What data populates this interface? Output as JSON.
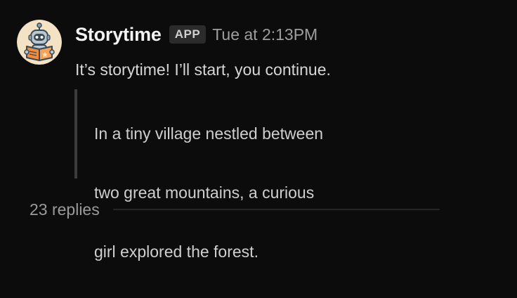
{
  "message": {
    "author": "Storytime",
    "badge": "APP",
    "timestamp": "Tue at 2:13PM",
    "text": "It’s storytime! I’ll start, you continue.",
    "quote_lines": [
      "In a tiny village nestled between",
      "two great mountains, a curious",
      "girl explored the forest."
    ],
    "replies": "23 replies"
  },
  "avatar": {
    "icon": "robot-reading-book-icon",
    "background": "#f3e3c4",
    "book_color": "#f08a3c"
  },
  "colors": {
    "background": "#0c0c0c",
    "author": "#f2f2f2",
    "text": "#d6d6d6",
    "muted": "#9e9e9e",
    "badge_bg": "#2b2b2b",
    "quote_bar": "#3c3c3c"
  }
}
